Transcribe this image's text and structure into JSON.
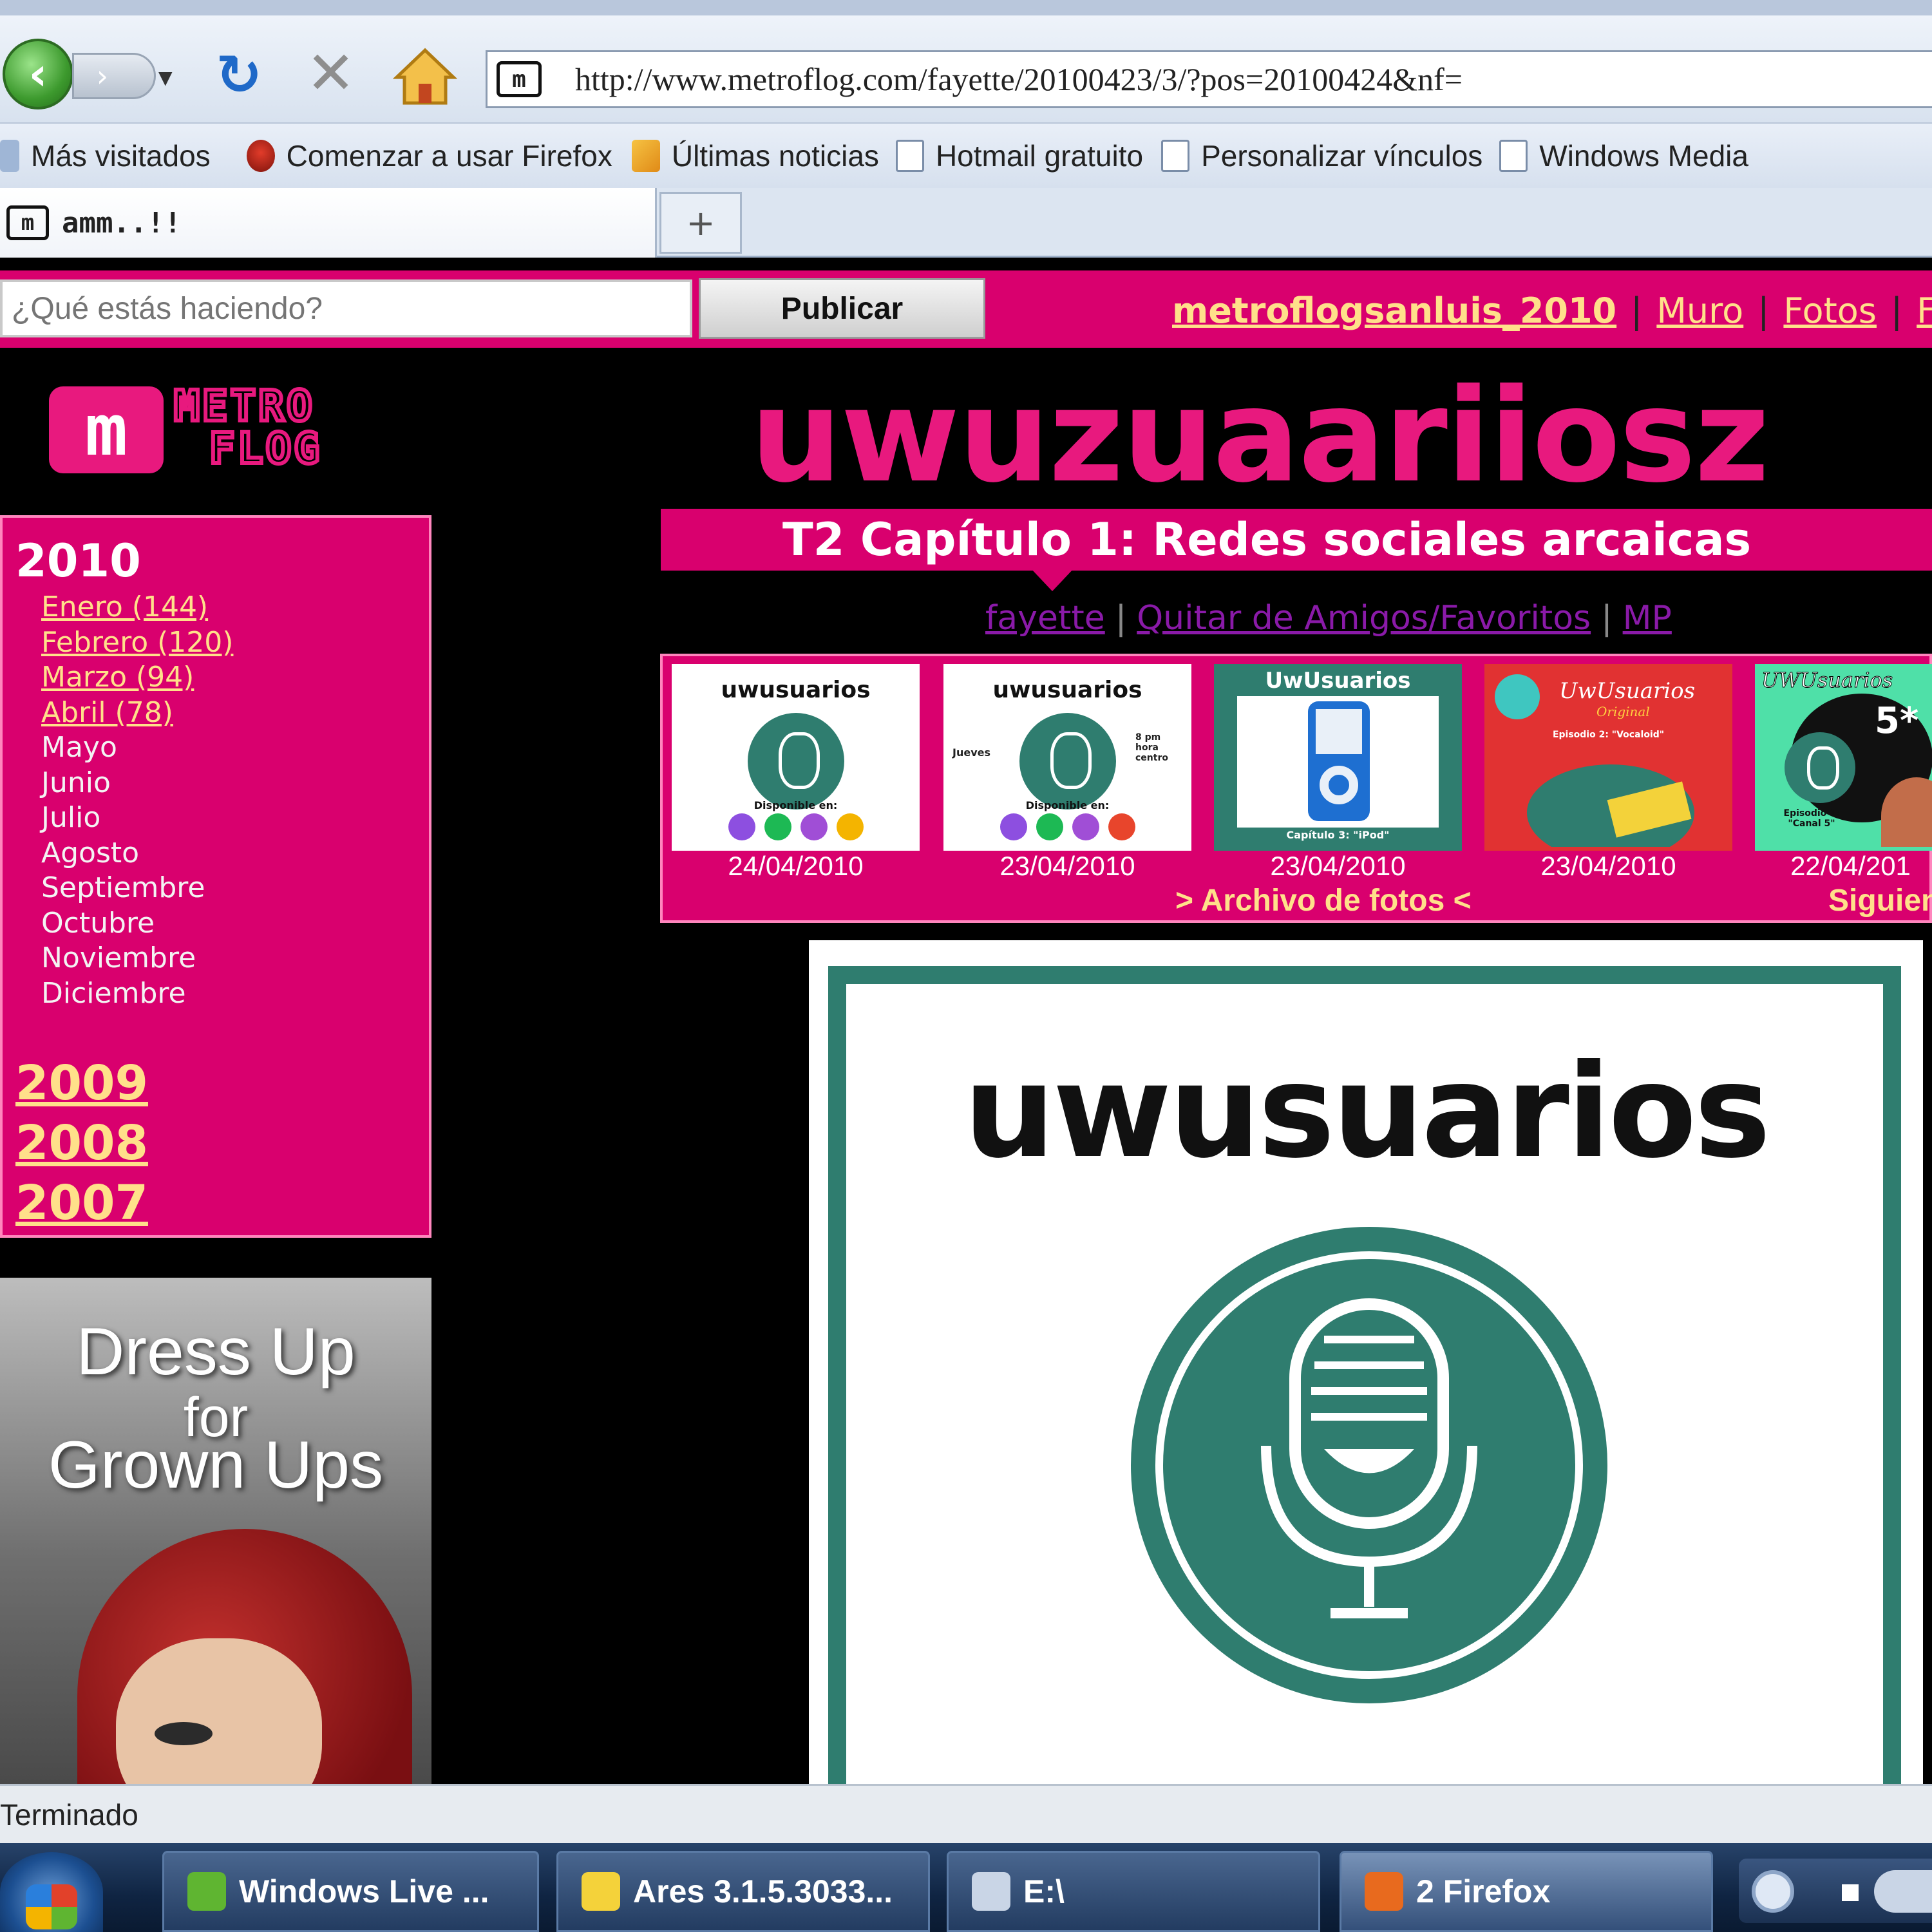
{
  "browser": {
    "url": "http://www.metroflog.com/fayette/20100423/3/?pos=20100424&nf=",
    "site_icon_glyph": "m",
    "bookmarks": [
      {
        "label": "Más visitados",
        "icon": "star-icon"
      },
      {
        "label": "Comenzar a usar Firefox",
        "icon": "firefox-icon"
      },
      {
        "label": "Últimas noticias",
        "icon": "rss-icon"
      },
      {
        "label": "Hotmail gratuito",
        "icon": "page-icon"
      },
      {
        "label": "Personalizar vínculos",
        "icon": "page-icon"
      },
      {
        "label": "Windows Media",
        "icon": "page-icon"
      }
    ],
    "tab": {
      "title": "amm..!!",
      "new_tab_glyph": "+"
    },
    "status_text": "Terminado"
  },
  "topbar": {
    "status_placeholder": "¿Qué estás haciendo?",
    "publish_label": "Publicar",
    "user": "metroflogsanluis_2010",
    "links": [
      "Muro",
      "Fotos",
      "Fav"
    ]
  },
  "logo": {
    "glyph": "m",
    "line1": "METRO",
    "line2": "FLOG"
  },
  "header": {
    "site_title": "uwuzuaariiosz",
    "post_title": "T2 Capítulo 1: Redes sociales arcaicas",
    "owner_links": [
      "fayette",
      "Quitar de Amigos/Favoritos",
      "MP"
    ]
  },
  "sidebar": {
    "current_year": "2010",
    "months": [
      {
        "label": "Enero (144)",
        "link": true
      },
      {
        "label": "Febrero (120)",
        "link": true
      },
      {
        "label": "Marzo (94)",
        "link": true
      },
      {
        "label": "Abril (78)",
        "link": true
      },
      {
        "label": "Mayo",
        "link": false
      },
      {
        "label": "Junio",
        "link": false
      },
      {
        "label": "Julio",
        "link": false
      },
      {
        "label": "Agosto",
        "link": false
      },
      {
        "label": "Septiembre",
        "link": false
      },
      {
        "label": "Octubre",
        "link": false
      },
      {
        "label": "Noviembre",
        "link": false
      },
      {
        "label": "Diciembre",
        "link": false
      }
    ],
    "past_years": [
      "2009",
      "2008",
      "2007"
    ]
  },
  "ad": {
    "line1": "Dress Up",
    "line2": "for",
    "line3": "Grown Ups"
  },
  "photo_strip": {
    "thumbs": [
      {
        "title": "uwusuarios",
        "caption": "Disponible en:",
        "date": "24/04/2010"
      },
      {
        "title": "uwusuarios",
        "caption": "Disponible en:",
        "side_left": "Jueves",
        "side_right": "8 pm hora centro",
        "date": "23/04/2010"
      },
      {
        "title": "UwUsuarios",
        "caption": "Capítulo 3: \"iPod\"",
        "date": "23/04/2010"
      },
      {
        "title": "UwUsuarios",
        "subtitle": "Original",
        "caption": "Episodio 2: \"Vocaloid\"",
        "date": "23/04/2010"
      },
      {
        "title": "UWUsuarios",
        "caption": "Episodio 1: \"Canal 5\"",
        "badge": "5*",
        "date": "22/04/201"
      }
    ],
    "archive_label": ">  Archivo de fotos  <",
    "next_label": "Siguien"
  },
  "main_photo": {
    "title": "uwusuarios"
  },
  "taskbar": {
    "items": [
      {
        "label": "Windows Live ...",
        "active": false
      },
      {
        "label": "Ares 3.1.5.3033...",
        "active": false
      },
      {
        "label": "E:\\",
        "active": false
      },
      {
        "label": "2 Firefox",
        "active": true
      }
    ]
  },
  "colors": {
    "brand_pink": "#d9006e",
    "title_pink": "#e8197e",
    "link_yellow": "#ffe08a",
    "podcast_teal": "#2f7d6f"
  }
}
